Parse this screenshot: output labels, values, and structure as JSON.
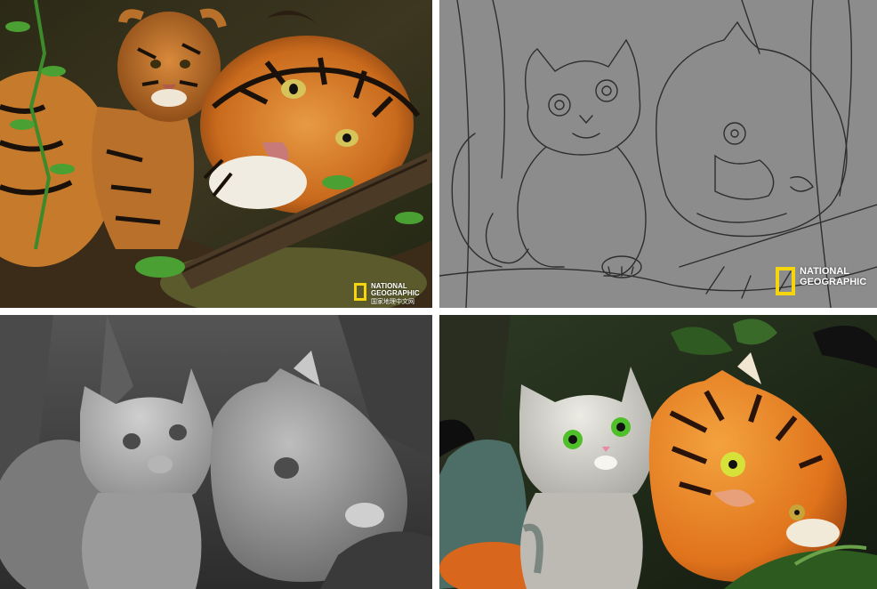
{
  "panels": {
    "photo": {
      "logo": {
        "line1": "NATIONAL",
        "line2": "GEOGRAPHIC",
        "line3": "国家地理中文网",
        "frame_color": "#f5d60e"
      }
    },
    "sketch": {
      "logo": {
        "line1": "NATIONAL",
        "line2": "GEOGRAPHIC",
        "frame_color": "#f5d60e"
      }
    },
    "gray": {},
    "color": {}
  },
  "colors": {
    "separator": "#ffffff",
    "tiger_orange": "#e0731c",
    "sketch_bg": "#8a8a8a",
    "render_gray": "#6e6e6e",
    "cat_white": "#d9d6cf",
    "eye_green": "#4fbf2a"
  }
}
